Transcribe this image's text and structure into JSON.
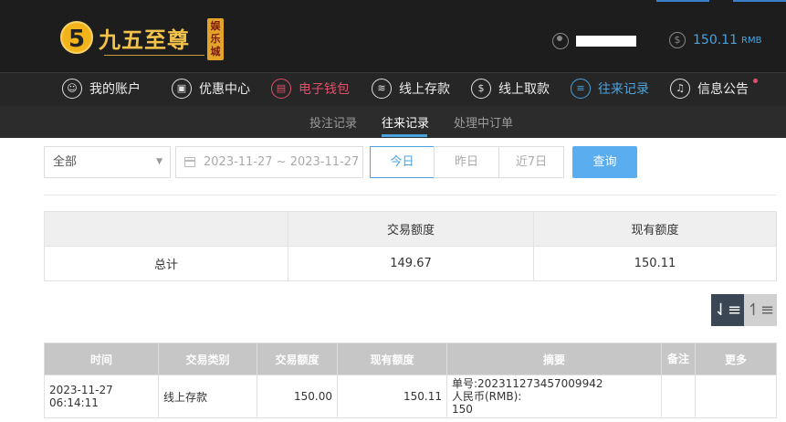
{
  "header": {
    "logo_mark": "5",
    "logo_text": "九五至尊",
    "logo_sub": "娱乐城",
    "balance": "150.11",
    "balance_unit": "RMB"
  },
  "nav": {
    "items": [
      {
        "label": "我的账户",
        "icon": "user-icon"
      },
      {
        "label": "优惠中心",
        "icon": "gift-icon"
      },
      {
        "label": "电子钱包",
        "icon": "wallet-icon"
      },
      {
        "label": "线上存款",
        "icon": "deposit-icon"
      },
      {
        "label": "线上取款",
        "icon": "withdraw-icon"
      },
      {
        "label": "往来记录",
        "icon": "record-icon"
      },
      {
        "label": "信息公告",
        "icon": "bell-icon"
      }
    ]
  },
  "subnav": {
    "items": [
      "投注记录",
      "往来记录",
      "处理中订单"
    ],
    "active": "往来记录"
  },
  "filter": {
    "type_value": "全部",
    "date_range": "2023-11-27 ~ 2023-11-27",
    "quick": [
      "今日",
      "昨日",
      "近7日"
    ],
    "quick_selected": "今日",
    "query_label": "查询"
  },
  "summary": {
    "headers": [
      "",
      "交易额度",
      "现有额度"
    ],
    "row": {
      "label": "总计",
      "amount": "149.67",
      "balance": "150.11"
    }
  },
  "records": {
    "headers": [
      "时间",
      "交易类别",
      "交易额度",
      "现有额度",
      "摘要",
      "备注",
      "更多"
    ],
    "rows": [
      {
        "time": "2023-11-27 06:14:11",
        "type": "线上存款",
        "amount": "150.00",
        "balance": "150.11",
        "summary_line1": "单号:202311273457009942",
        "summary_line2": "人民币(RMB):",
        "summary_line3": "150",
        "note": "",
        "more": ""
      }
    ]
  },
  "colors": {
    "accent": "#4aa3df",
    "wallet": "#e0506a",
    "header_bg": "#1d1d1d",
    "logo_gold": "#f3c24a"
  }
}
